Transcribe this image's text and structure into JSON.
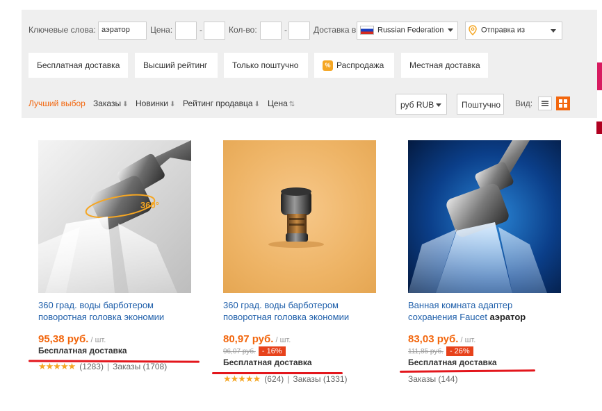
{
  "filters": {
    "keyword_label": "Ключевые слова:",
    "keyword_value": "аэратор",
    "price_label": "Цена:",
    "price_from": "",
    "price_to": "",
    "qty_label": "Кол-во:",
    "qty_from": "",
    "qty_to": "",
    "delivery_label": "Доставка в",
    "delivery_country": "Russian Federation",
    "ship_from": "Отправка из",
    "dash": "-"
  },
  "quick_filters": [
    "Бесплатная доставка",
    "Высший рейтинг",
    "Только поштучно",
    "Распродажа",
    "Местная доставка"
  ],
  "sort": {
    "items": [
      {
        "label": "Лучший выбор",
        "active": true
      },
      {
        "label": "Заказы",
        "arrow": "⬇"
      },
      {
        "label": "Новинки",
        "arrow": "⬇"
      },
      {
        "label": "Рейтинг продавца",
        "arrow": "⬇"
      },
      {
        "label": "Цена",
        "arrow": "⇅"
      }
    ],
    "currency": "руб RUB",
    "unit_mode": "Поштучно",
    "view_label": "Вид:"
  },
  "products": [
    {
      "title_line1": "360 град. воды барботером",
      "title_line2": "поворотная головка экономии",
      "title_bold": "",
      "price": "95,38 руб.",
      "unit": "/ шт.",
      "old_price": "",
      "discount": "",
      "shipping": "Бесплатная доставка",
      "stars": "★★★★★",
      "reviews": "(1283)",
      "orders": "Заказы (1708)",
      "img_overlay": "360°"
    },
    {
      "title_line1": "360 град. воды барботером",
      "title_line2": "поворотная головка экономии",
      "title_bold": "",
      "price": "80,97 руб.",
      "unit": "/ шт.",
      "old_price": "96,07 руб.",
      "discount": "- 16%",
      "shipping": "Бесплатная доставка",
      "stars": "★★★★★",
      "reviews": "(624)",
      "orders": "Заказы (1331)"
    },
    {
      "title_line1": "Ванная комната адаптер",
      "title_line2": "сохранения Faucet ",
      "title_bold": "аэратор",
      "price": "83,03 руб.",
      "unit": "/ шт.",
      "old_price": "111,85 руб.",
      "discount": "- 26%",
      "shipping": "Бесплатная доставка",
      "stars": "",
      "reviews": "",
      "orders": "Заказы (144)"
    }
  ],
  "colors": {
    "accent": "#f2660d",
    "link": "#1f5faa",
    "annotation": "#e3161c",
    "discount": "#e7421b"
  },
  "icons": [
    "location-pin-icon",
    "sale-icon",
    "list-view-icon",
    "grid-view-icon"
  ]
}
